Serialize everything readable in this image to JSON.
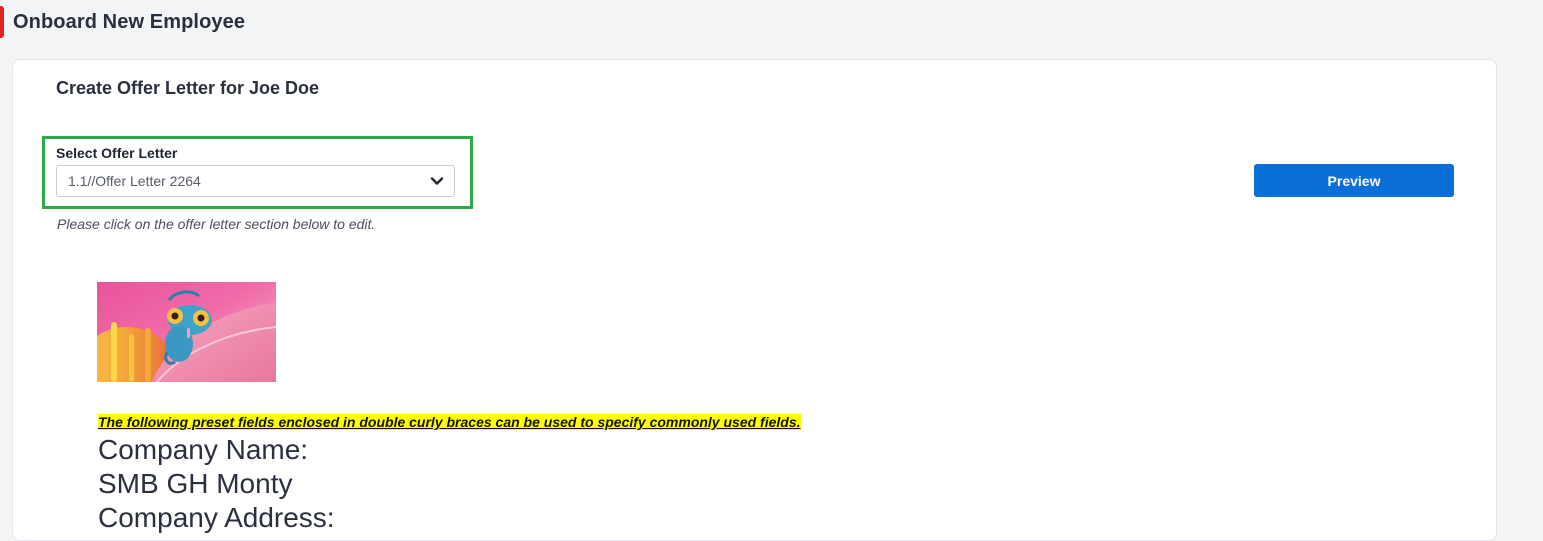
{
  "page": {
    "title": "Onboard New Employee",
    "accent_color": "#e02424"
  },
  "card": {
    "title": "Create Offer Letter for Joe Doe"
  },
  "offer_select": {
    "label": "Select Offer Letter",
    "value": "1.1//Offer Letter 2264",
    "hint": "Please click on the offer letter section below to edit.",
    "highlight_color": "#2ea84a"
  },
  "preview_button": {
    "label": "Preview",
    "color": "#0a6fd6"
  },
  "letter": {
    "logo_icon": "chameleon-on-flower-image",
    "notice": "The following preset fields enclosed in double curly braces can be used to specify commonly used fields.",
    "lines": [
      "Company Name:",
      "SMB GH Monty",
      "Company Address:"
    ]
  }
}
